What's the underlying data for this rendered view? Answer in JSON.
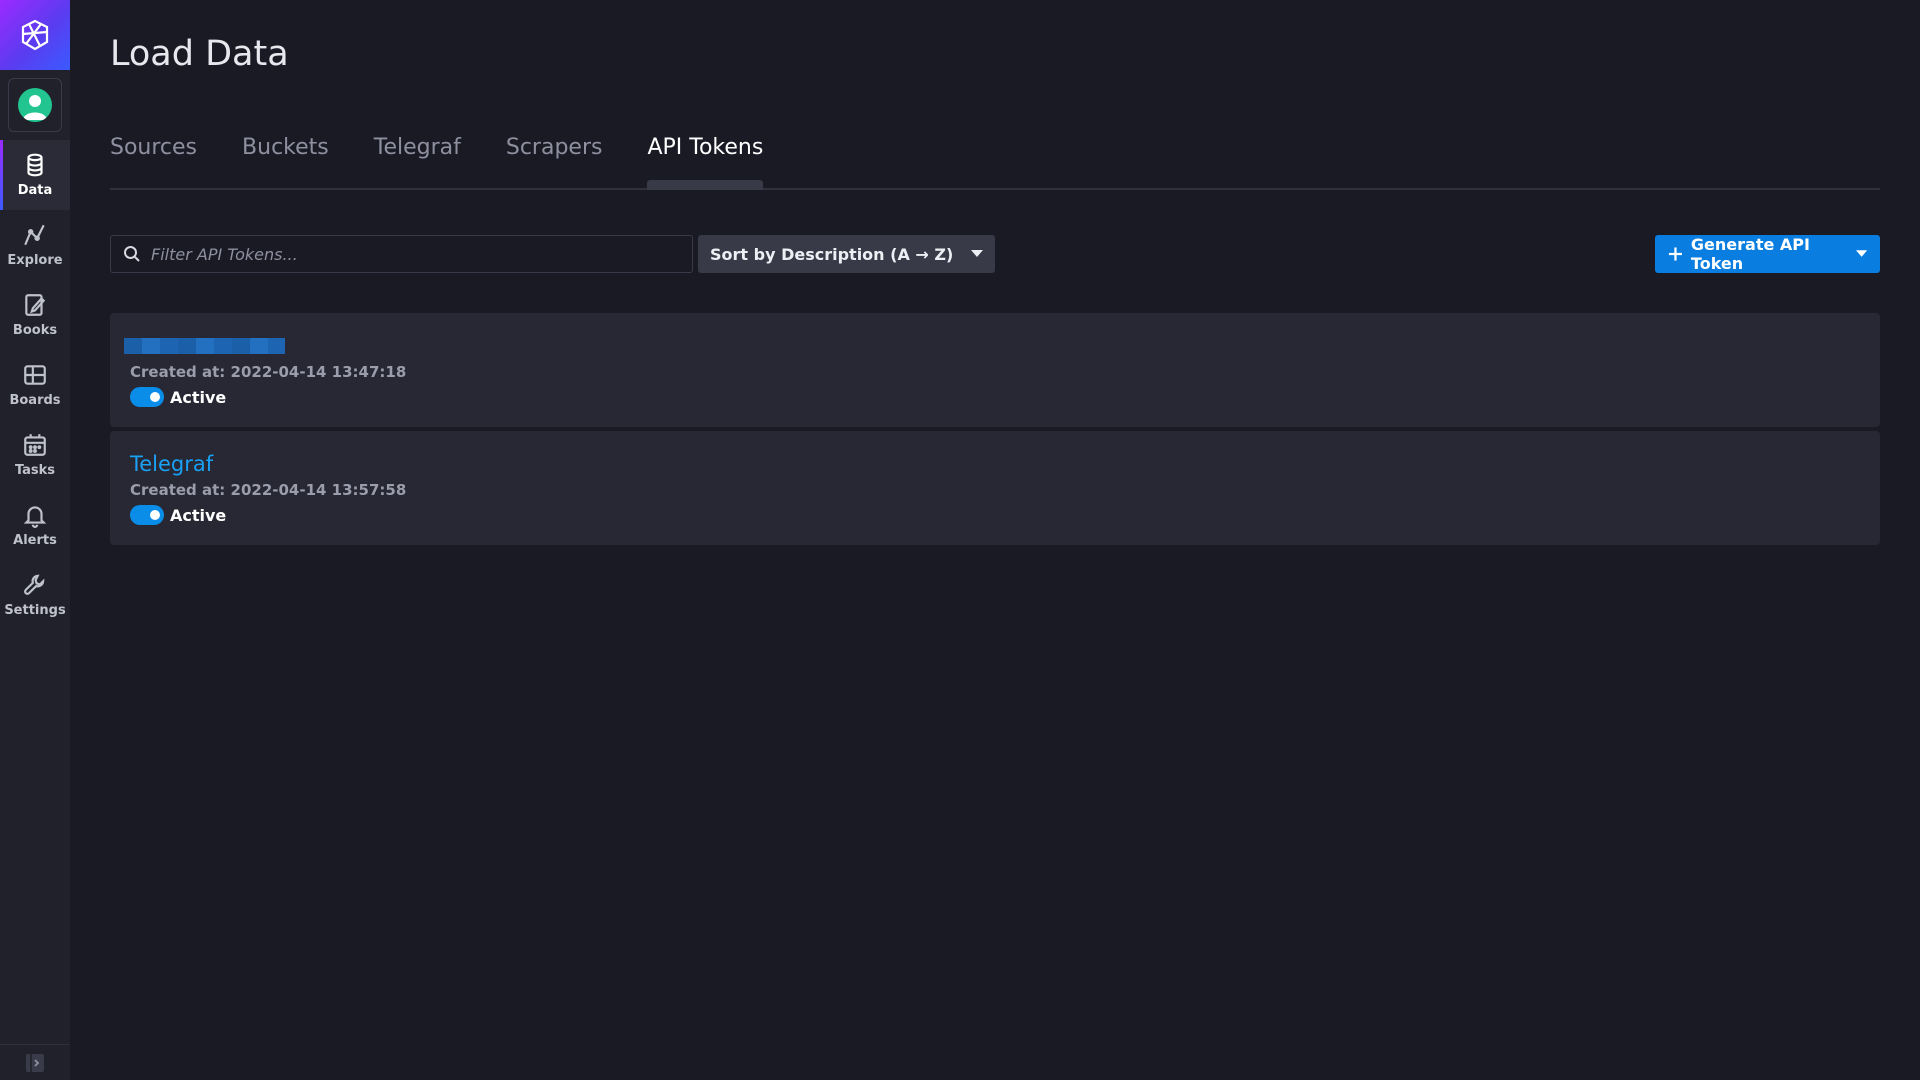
{
  "sidebar": {
    "logo_icon": "influx-logo-icon",
    "avatar_icon": "user-avatar-icon",
    "items": [
      {
        "label": "Data",
        "icon": "database-icon",
        "active": true
      },
      {
        "label": "Explore",
        "icon": "graph-icon",
        "active": false
      },
      {
        "label": "Books",
        "icon": "notebook-icon",
        "active": false
      },
      {
        "label": "Boards",
        "icon": "dashboard-grid-icon",
        "active": false
      },
      {
        "label": "Tasks",
        "icon": "calendar-icon",
        "active": false
      },
      {
        "label": "Alerts",
        "icon": "bell-icon",
        "active": false
      },
      {
        "label": "Settings",
        "icon": "wrench-icon",
        "active": false
      }
    ],
    "collapse_icon": "expand-sidebar-icon"
  },
  "page": {
    "title": "Load Data",
    "tabs": [
      {
        "label": "Sources",
        "active": false
      },
      {
        "label": "Buckets",
        "active": false
      },
      {
        "label": "Telegraf",
        "active": false
      },
      {
        "label": "Scrapers",
        "active": false
      },
      {
        "label": "API Tokens",
        "active": true
      }
    ]
  },
  "toolbar": {
    "search_placeholder": "Filter API Tokens...",
    "search_value": "",
    "sort_label": "Sort by Description (A → Z)",
    "generate_label": "Generate API Token"
  },
  "tokens": [
    {
      "name": "",
      "name_redacted": true,
      "created": "Created at: 2022-04-14 13:47:18",
      "status": "Active"
    },
    {
      "name": "Telegraf",
      "name_redacted": false,
      "created": "Created at: 2022-04-14 13:57:58",
      "status": "Active"
    }
  ],
  "colors": {
    "background": "#1a1a25",
    "sidebar": "#21212b",
    "accent_blue": "#0a7ee0",
    "link_blue": "#1aa0f5",
    "card": "#272834"
  }
}
